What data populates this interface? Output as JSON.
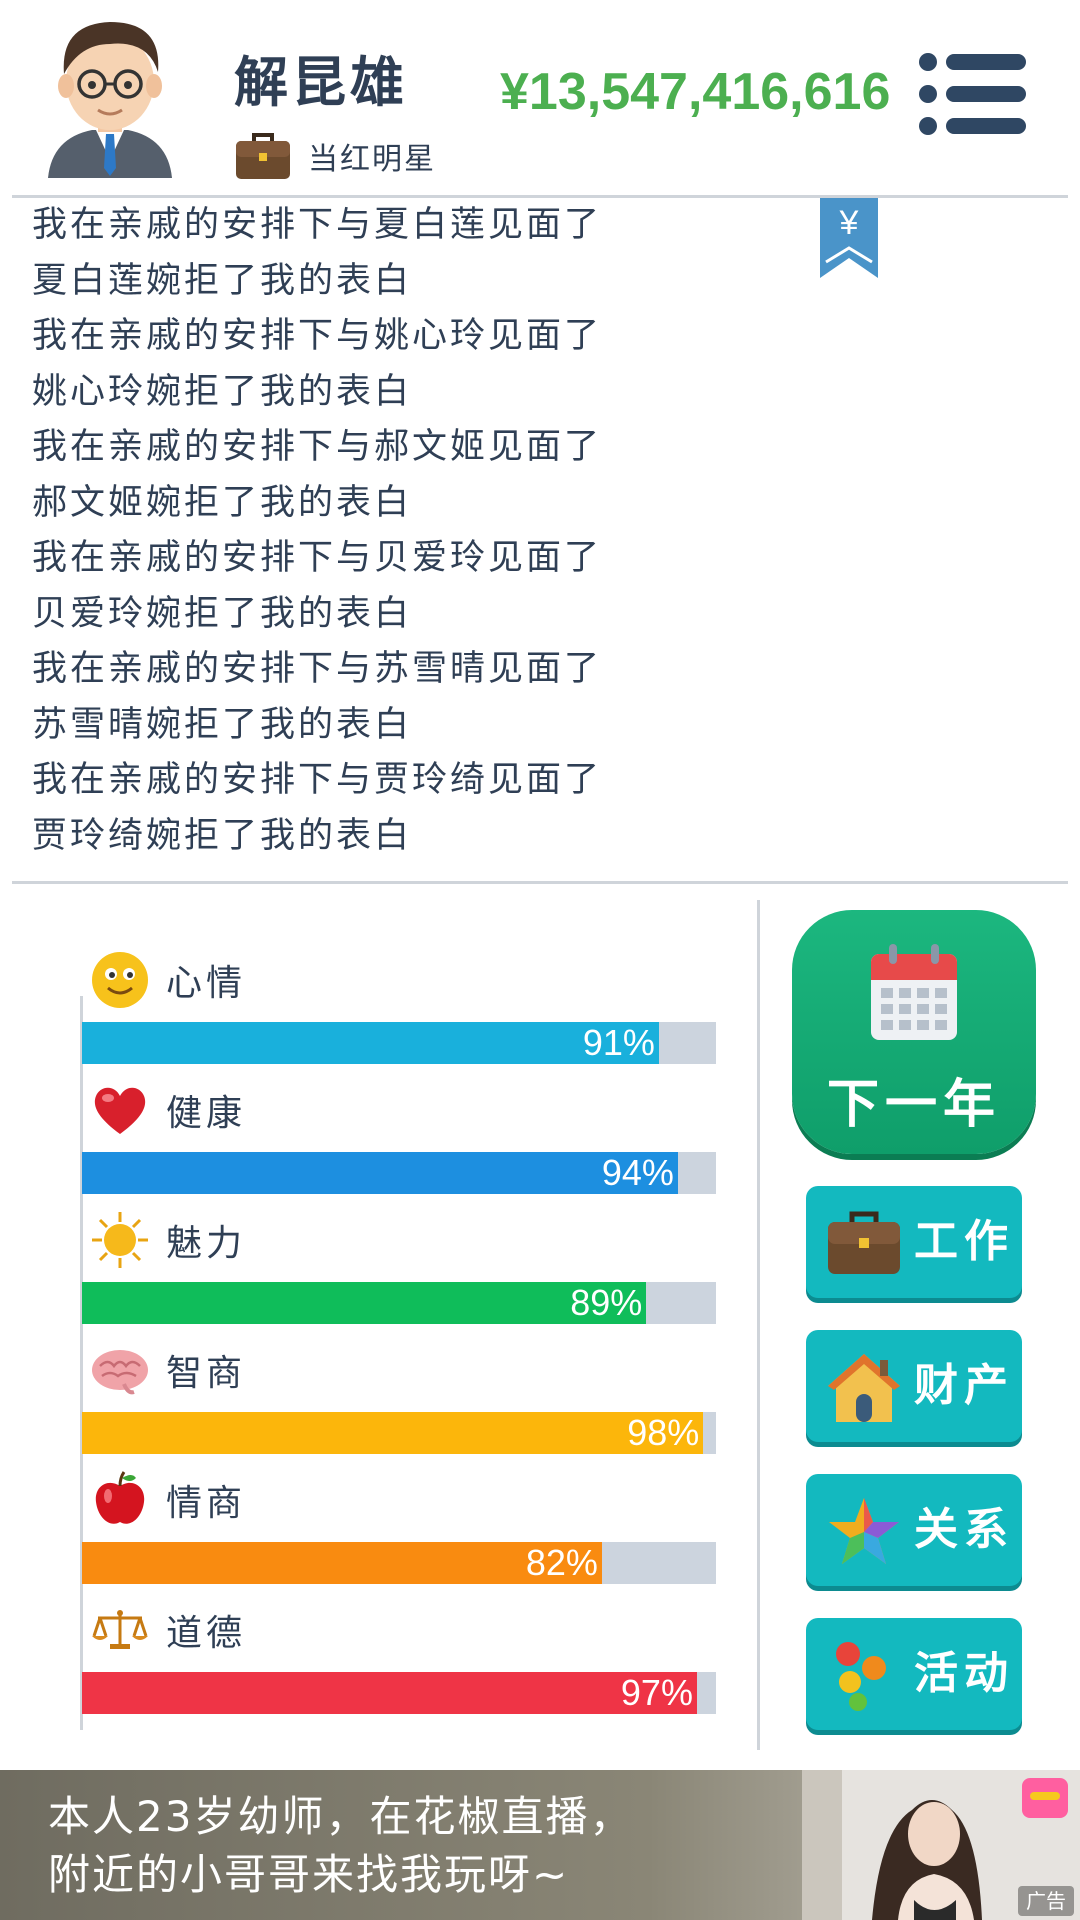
{
  "header": {
    "player_name": "解昆雄",
    "job_title": "当红明星",
    "money": "¥13,547,416,616"
  },
  "log": [
    "我在亲戚的安排下与夏白莲见面了",
    "夏白莲婉拒了我的表白",
    "我在亲戚的安排下与姚心玲见面了",
    "姚心玲婉拒了我的表白",
    "我在亲戚的安排下与郝文姬见面了",
    "郝文姬婉拒了我的表白",
    "我在亲戚的安排下与贝爱玲见面了",
    "贝爱玲婉拒了我的表白",
    "我在亲戚的安排下与苏雪晴见面了",
    "苏雪晴婉拒了我的表白",
    "我在亲戚的安排下与贾玲绮见面了",
    "贾玲绮婉拒了我的表白"
  ],
  "bookmark_symbol": "¥",
  "stats": [
    {
      "label": "心情",
      "value": 91,
      "display": "91%",
      "color": "#19b0dc",
      "icon": "smiley-icon"
    },
    {
      "label": "健康",
      "value": 94,
      "display": "94%",
      "color": "#1d8fe0",
      "icon": "heart-icon"
    },
    {
      "label": "魅力",
      "value": 89,
      "display": "89%",
      "color": "#0fbd5a",
      "icon": "sun-icon"
    },
    {
      "label": "智商",
      "value": 98,
      "display": "98%",
      "color": "#fcb60b",
      "icon": "brain-icon"
    },
    {
      "label": "情商",
      "value": 82,
      "display": "82%",
      "color": "#f98b10",
      "icon": "apple-icon"
    },
    {
      "label": "道德",
      "value": 97,
      "display": "97%",
      "color": "#ef3446",
      "icon": "scales-icon"
    }
  ],
  "actions": {
    "next_year": "下一年",
    "work": "工作",
    "property": "财产",
    "relations": "关系",
    "activities": "活动"
  },
  "ad": {
    "line1": "本人23岁幼师，在花椒直播，",
    "line2": "附近的小哥哥来找我玩呀~",
    "tag": "广告"
  }
}
